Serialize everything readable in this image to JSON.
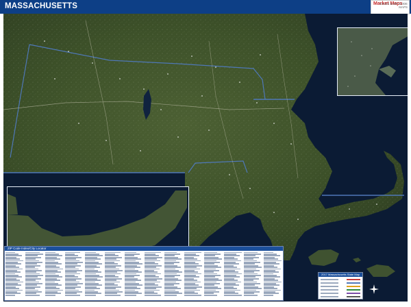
{
  "header": {
    "title": "MASSACHUSETTS",
    "brand_primary": "Market Maps",
    "brand_tag": "SALES & ZIP CODE MAPS"
  },
  "map": {
    "style": "satellite imagery wall map",
    "colors": {
      "ocean": "#0b1b34",
      "land": "#3c4f2c",
      "boundary": "#4f78b8",
      "header": "#0d3f86",
      "inset_border": "#e6eef9"
    },
    "insets": [
      {
        "name": "Boston metro inset"
      },
      {
        "name": "Cape Cod inset"
      }
    ],
    "compass_icon": "north-arrow-icon"
  },
  "zip_index": {
    "header_text": "ZIP Code Index/City Locator"
  },
  "legend": {
    "title": "2017 Massachusetts State Map"
  }
}
